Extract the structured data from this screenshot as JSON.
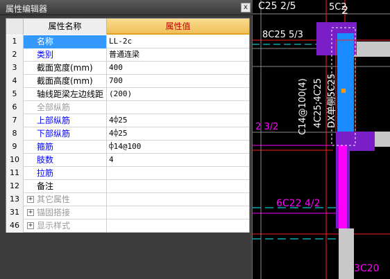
{
  "window": {
    "title": "属性编辑器",
    "close_glyph": "x"
  },
  "grid": {
    "col_name_header": "属性名称",
    "col_value_header": "属性值",
    "rows": [
      {
        "num": "1",
        "name": "名称",
        "value": "LL-2c",
        "color": "blue",
        "selected": true
      },
      {
        "num": "2",
        "name": "类别",
        "value": "普通连梁",
        "color": "blue"
      },
      {
        "num": "3",
        "name": "截面宽度(mm)",
        "value": "400",
        "color": "black"
      },
      {
        "num": "4",
        "name": "截面高度(mm)",
        "value": "700",
        "color": "black"
      },
      {
        "num": "5",
        "name": "轴线距梁左边线距",
        "value": "(200)",
        "color": "black"
      },
      {
        "num": "6",
        "name": "全部纵筋",
        "value": "",
        "color": "gray"
      },
      {
        "num": "7",
        "name": "上部纵筋",
        "value": "4⌽25",
        "color": "blue"
      },
      {
        "num": "8",
        "name": "下部纵筋",
        "value": "4⌽25",
        "color": "blue"
      },
      {
        "num": "9",
        "name": "箍筋",
        "value": "⌽14@100",
        "color": "blue"
      },
      {
        "num": "10",
        "name": "肢数",
        "value": "4",
        "color": "blue"
      },
      {
        "num": "11",
        "name": "拉筋",
        "value": "",
        "color": "blue"
      },
      {
        "num": "12",
        "name": "备注",
        "value": "",
        "color": "black"
      },
      {
        "num": "13",
        "name": "其它属性",
        "value": "",
        "color": "gray",
        "group": true
      },
      {
        "num": "31",
        "name": "锚固搭接",
        "value": "",
        "color": "gray",
        "group": true
      },
      {
        "num": "46",
        "name": "显示样式",
        "value": "",
        "color": "gray",
        "group": true
      }
    ],
    "expand_glyph": "+"
  },
  "cad": {
    "colors": {
      "magenta": "#ff00ff",
      "purple": "#6a1fb0",
      "blue": "#1a8cff",
      "cyan": "#00ffff",
      "red": "#ff2020",
      "white": "#ffffff",
      "orange": "#ff9a00",
      "gray": "#8a8a8a"
    },
    "labels": [
      {
        "id": "top-rebar-label",
        "text": "C25 2/5"
      },
      {
        "id": "top-right-label",
        "text": "5C2"
      },
      {
        "id": "axis-number",
        "text": "2"
      },
      {
        "id": "beam-top-label",
        "text": "8C25 5/3"
      },
      {
        "id": "vertical-label-1",
        "text": "C14@100(4)"
      },
      {
        "id": "vertical-label-2",
        "text": "4C25;4C25"
      },
      {
        "id": "vertical-label-3",
        "text": "DX单侧5C25"
      },
      {
        "id": "left-edge-label",
        "text": "2 3/2"
      },
      {
        "id": "lower-beam-label",
        "text": "6C22 4/2"
      },
      {
        "id": "bottom-right-label",
        "text": "3C20"
      }
    ]
  }
}
